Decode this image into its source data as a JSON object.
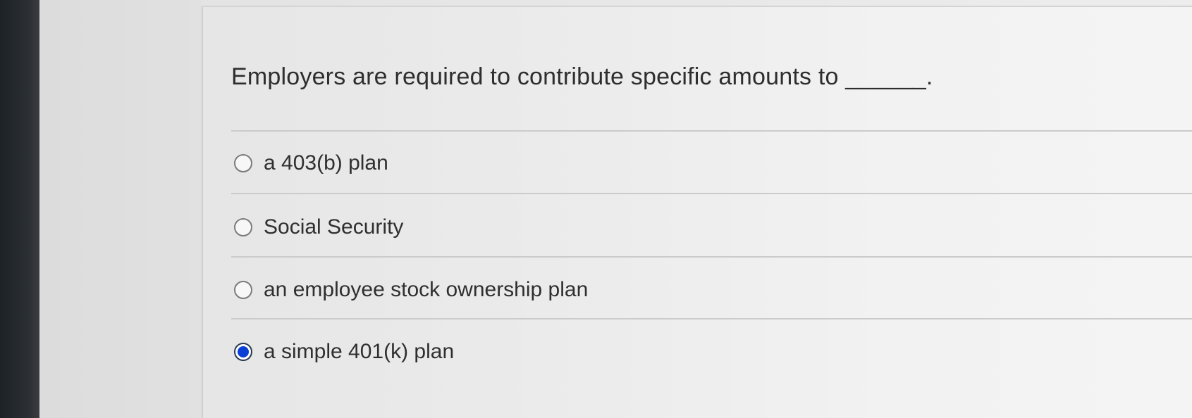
{
  "question": {
    "text": "Employers are required to contribute specific amounts to ______."
  },
  "options": [
    {
      "label": "a 403(b) plan",
      "selected": false
    },
    {
      "label": "Social Security",
      "selected": false
    },
    {
      "label": "an employee stock ownership plan",
      "selected": false
    },
    {
      "label": "a simple 401(k) plan",
      "selected": true
    }
  ],
  "colors": {
    "selected_radio": "#0a3fd6",
    "text": "#2f2f2f",
    "divider": "#cbcbcb"
  }
}
